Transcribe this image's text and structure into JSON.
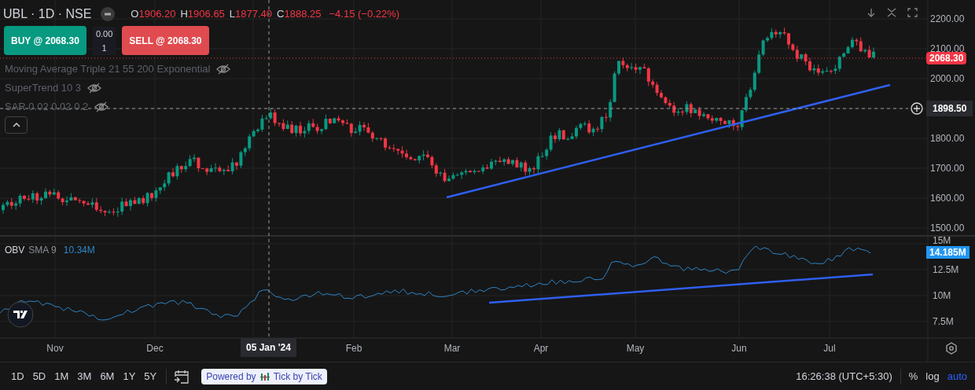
{
  "header": {
    "symbol": "UBL · 1D · NSE",
    "ohlc": [
      {
        "letter": "O",
        "value": "1906.20"
      },
      {
        "letter": "H",
        "value": "1906.65"
      },
      {
        "letter": "L",
        "value": "1877.40"
      },
      {
        "letter": "C",
        "value": "1888.25"
      }
    ],
    "change": "−4.15 (−0.22%)"
  },
  "trade": {
    "buy": "BUY @ 2068.30",
    "spread": "0.00",
    "quantity": "1",
    "sell": "SELL @ 2068.30"
  },
  "indicators": [
    {
      "label": "Moving Average Triple 21 55 200 Exponential",
      "hidden": true
    },
    {
      "label": "SuperTrend 10 3",
      "hidden": true
    },
    {
      "label": "SAR 0.02 0.02 0.2",
      "hidden": true
    }
  ],
  "price_axis": {
    "ticks": [
      "2200.00",
      "2100.00",
      "2000.00",
      "1800.00",
      "1700.00",
      "1600.00",
      "1500.00"
    ],
    "last_price": "2068.30",
    "crosshair_price": "1898.50"
  },
  "obv": {
    "title": "OBV",
    "params": "SMA 9",
    "value": "10.34M",
    "ticks": [
      "15M",
      "12.5M",
      "10M",
      "7.5M"
    ],
    "last_value": "14.185M"
  },
  "time_axis": {
    "labels": [
      "Nov",
      "Dec",
      "Feb",
      "Mar",
      "Apr",
      "May",
      "Jun",
      "Jul"
    ],
    "crosshair_date": "05 Jan '24"
  },
  "ranges": [
    "1D",
    "5D",
    "1M",
    "3M",
    "6M",
    "1Y",
    "5Y"
  ],
  "powered_by": {
    "prefix": "Powered by",
    "name": "Tick by Tick"
  },
  "clock": "16:26:38 (UTC+5:30)",
  "scale_options": [
    {
      "label": "%",
      "selected": false
    },
    {
      "label": "log",
      "selected": false
    },
    {
      "label": "auto",
      "selected": true
    }
  ]
}
